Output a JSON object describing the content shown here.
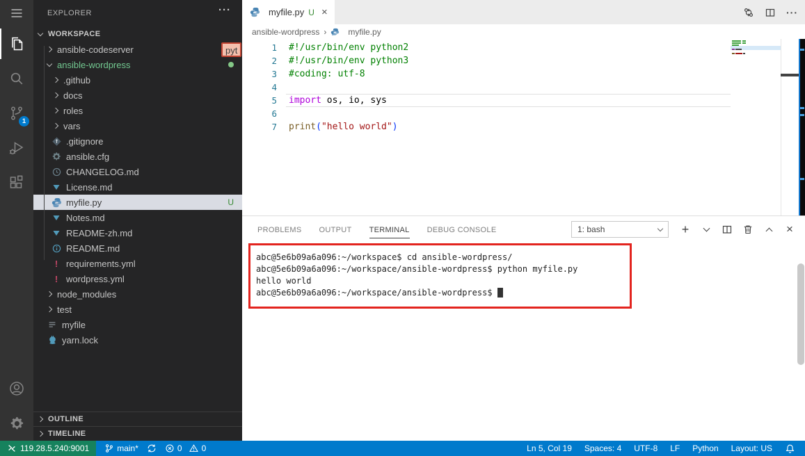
{
  "colors": {
    "accent_blue": "#007acc",
    "remote_green": "#16825d",
    "annotation_red": "#e3241e",
    "untracked_green": "#73c991",
    "badge_blue": "#007acc"
  },
  "icons": {
    "close": "×",
    "more": "···",
    "new_terminal": "+",
    "breadcrumb_separator": "›"
  },
  "activity_bar": {
    "scm_badge": "1"
  },
  "sidebar": {
    "header": "EXPLORER",
    "workspace_label": "WORKSPACE",
    "outline_label": "OUTLINE",
    "timeline_label": "TIMELINE",
    "overlay_badge": "pyt",
    "tree": [
      {
        "label": "ansible-codeserver",
        "depth": 1,
        "kind": "folder",
        "chevron": "right"
      },
      {
        "label": "ansible-wordpress",
        "depth": 1,
        "kind": "folder",
        "chevron": "down",
        "green": true,
        "dot": true
      },
      {
        "label": ".github",
        "depth": 2,
        "kind": "folder",
        "chevron": "right"
      },
      {
        "label": "docs",
        "depth": 2,
        "kind": "folder",
        "chevron": "right"
      },
      {
        "label": "roles",
        "depth": 2,
        "kind": "folder",
        "chevron": "right"
      },
      {
        "label": "vars",
        "depth": 2,
        "kind": "folder",
        "chevron": "right"
      },
      {
        "label": ".gitignore",
        "depth": 2,
        "kind": "file",
        "icon": "git"
      },
      {
        "label": "ansible.cfg",
        "depth": 2,
        "kind": "file",
        "icon": "gear"
      },
      {
        "label": "CHANGELOG.md",
        "depth": 2,
        "kind": "file",
        "icon": "clock"
      },
      {
        "label": "License.md",
        "depth": 2,
        "kind": "file",
        "icon": "md"
      },
      {
        "label": "myfile.py",
        "depth": 2,
        "kind": "file",
        "icon": "python",
        "selected": true,
        "badge": "U"
      },
      {
        "label": "Notes.md",
        "depth": 2,
        "kind": "file",
        "icon": "md"
      },
      {
        "label": "README-zh.md",
        "depth": 2,
        "kind": "file",
        "icon": "md"
      },
      {
        "label": "README.md",
        "depth": 2,
        "kind": "file",
        "icon": "info"
      },
      {
        "label": "requirements.yml",
        "depth": 2,
        "kind": "file",
        "icon": "bang"
      },
      {
        "label": "wordpress.yml",
        "depth": 2,
        "kind": "file",
        "icon": "bang"
      },
      {
        "label": "node_modules",
        "depth": 1,
        "kind": "folder",
        "chevron": "right"
      },
      {
        "label": "test",
        "depth": 1,
        "kind": "folder",
        "chevron": "right"
      },
      {
        "label": "myfile",
        "depth": 1,
        "kind": "file",
        "icon": "lines"
      },
      {
        "label": "yarn.lock",
        "depth": 1,
        "kind": "file",
        "icon": "yarn"
      }
    ]
  },
  "editor": {
    "tab": {
      "title": "myfile.py",
      "git_badge": "U"
    },
    "breadcrumb": {
      "folder": "ansible-wordpress",
      "file": "myfile.py"
    },
    "code_lines": [
      {
        "num": "1",
        "tokens": [
          {
            "t": "#!/usr/bin/env python2",
            "c": "comment"
          }
        ]
      },
      {
        "num": "2",
        "tokens": [
          {
            "t": "#!/usr/bin/env python3",
            "c": "comment"
          }
        ]
      },
      {
        "num": "3",
        "tokens": [
          {
            "t": "#coding: utf-8",
            "c": "comment"
          }
        ]
      },
      {
        "num": "4",
        "tokens": []
      },
      {
        "num": "5",
        "tokens": [
          {
            "t": "import",
            "c": "keyword"
          },
          {
            "t": " os, io, sys",
            "c": "plain"
          }
        ],
        "current": true
      },
      {
        "num": "6",
        "tokens": []
      },
      {
        "num": "7",
        "tokens": [
          {
            "t": "print",
            "c": "func"
          },
          {
            "t": "(",
            "c": "paren"
          },
          {
            "t": "\"hello world\"",
            "c": "string"
          },
          {
            "t": ")",
            "c": "paren"
          }
        ]
      }
    ]
  },
  "panel": {
    "tabs": [
      {
        "label": "PROBLEMS"
      },
      {
        "label": "OUTPUT"
      },
      {
        "label": "TERMINAL",
        "active": true
      },
      {
        "label": "DEBUG CONSOLE"
      }
    ],
    "terminal_select": "1: bash",
    "terminal_lines": [
      "abc@5e6b09a6a096:~/workspace$ cd ansible-wordpress/",
      "abc@5e6b09a6a096:~/workspace/ansible-wordpress$ python myfile.py",
      "hello world",
      "abc@5e6b09a6a096:~/workspace/ansible-wordpress$ "
    ]
  },
  "status_bar": {
    "remote": "119.28.5.240:9001",
    "branch": "main*",
    "errors": "0",
    "warnings": "0",
    "items_right": [
      "Ln 5, Col 19",
      "Spaces: 4",
      "UTF-8",
      "LF",
      "Python",
      "Layout: US"
    ]
  }
}
